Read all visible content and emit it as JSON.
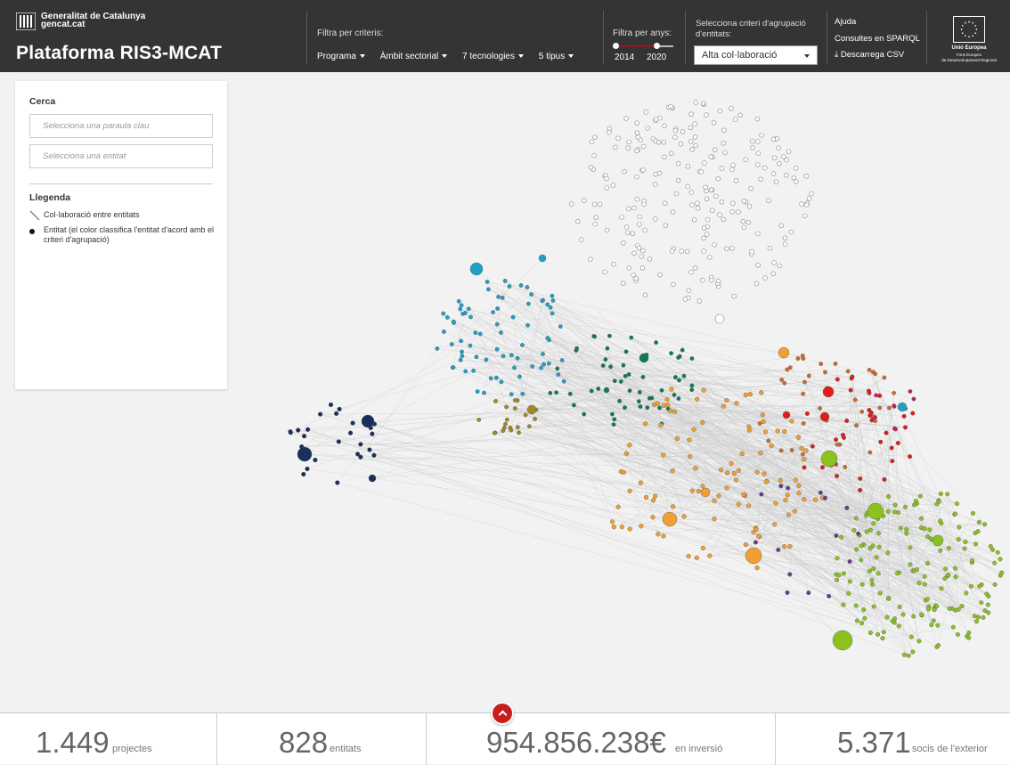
{
  "header": {
    "gov_line1": "Generalitat de Catalunya",
    "gov_line2": "gencat.cat",
    "title": "Plataforma RIS3-MCAT",
    "filters_title": "Filtra per criteris:",
    "filters": [
      {
        "label": "Programa"
      },
      {
        "label": "Àmbit sectorial"
      },
      {
        "label": "7 tecnologies"
      },
      {
        "label": "5 tipus"
      }
    ],
    "years_title": "Filtra per anys:",
    "year_min": "2014",
    "year_max": "2020",
    "grouping_title": "Selecciona criteri d'agrupació d'entitats:",
    "grouping_value": "Alta col·laboració",
    "help_label": "Ajuda",
    "sparql_label": "Consultes en SPARQL",
    "csv_label": "Descarrega CSV",
    "eu_name": "Unió Europea",
    "eu_fund_line1": "Fons Europeu",
    "eu_fund_line2": "de Desenvolupament Regional"
  },
  "sidebar": {
    "search_title": "Cerca",
    "keyword_placeholder": "Selecciona una paraula clau",
    "entity_placeholder": "Selecciona una entitat",
    "legend_title": "Llegenda",
    "legend_line": "Col·laboració entre entitats",
    "legend_dot": "Entitat (el color classifica l'entitat d'acord amb el criteri d'agrupació)"
  },
  "colors": {
    "header_bg": "#343434",
    "accent_red": "#c81d1d",
    "clusters": [
      "#ffffff",
      "#1fa0c8",
      "#0e7a5a",
      "#1a2f5c",
      "#f0a030",
      "#e31b1b",
      "#8cc21e",
      "#a0892a",
      "#d06a2a",
      "#6a3a8a",
      "#c02060"
    ]
  },
  "stats": [
    {
      "value": "1.449",
      "label": "projectes"
    },
    {
      "value": "828",
      "label": "entitats"
    },
    {
      "value": "954.856.238€",
      "label": "en inversió"
    },
    {
      "value": "5.371",
      "label": "socis de l'exterior"
    }
  ]
}
